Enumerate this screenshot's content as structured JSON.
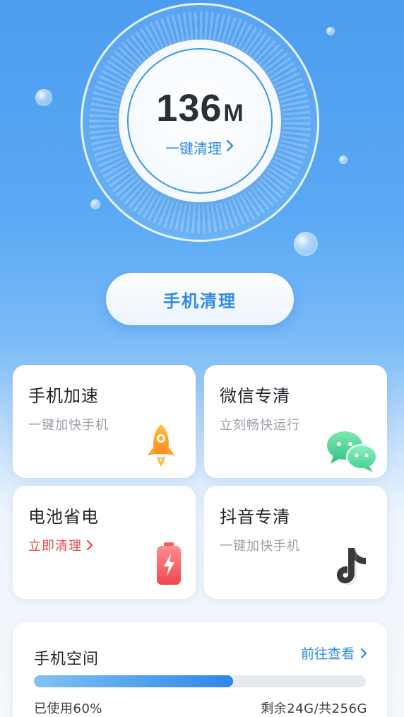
{
  "hero": {
    "junk_size": "136",
    "junk_unit": "M",
    "clean_link_label": "一键清理",
    "clean_link_icon": "chevron-right-icon"
  },
  "main_button": {
    "label": "手机清理"
  },
  "features": [
    {
      "title": "手机加速",
      "subtitle": "一键加快手机",
      "icon": "rocket-icon"
    },
    {
      "title": "微信专清",
      "subtitle": "立刻畅快运行",
      "icon": "wechat-icon"
    },
    {
      "title": "电池省电",
      "subtitle": "立即清理",
      "subtitle_icon": "chevron-right-icon",
      "icon": "battery-icon",
      "subtitle_color": "#e84a4a"
    },
    {
      "title": "抖音专清",
      "subtitle": "一键加快手机",
      "icon": "tiktok-icon"
    }
  ],
  "storage": {
    "title": "手机空间",
    "link_label": "前往查看",
    "link_icon": "chevron-right-icon",
    "used_label": "已使用60%",
    "used_fraction": 0.6,
    "free_label": "剩余24G/共256G"
  },
  "colors": {
    "accent": "#2e8ae2",
    "background_top": "#4b9df0",
    "alert": "#e84a4a"
  }
}
